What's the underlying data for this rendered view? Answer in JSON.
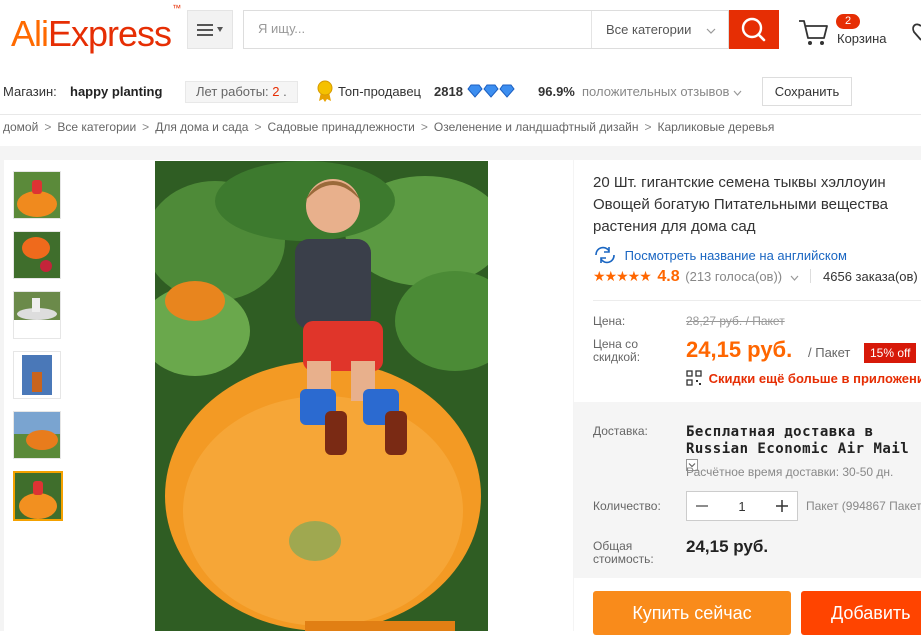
{
  "header": {
    "logo_part1": "Ali",
    "logo_part2": "Express",
    "logo_tm": "™",
    "search_placeholder": "Я ищу...",
    "category_select": "Все категории",
    "cart_count": "2",
    "cart_label": "Корзина"
  },
  "store": {
    "store_label": "Магазин:",
    "store_name": "happy planting",
    "years_label": "Лет работы:",
    "years_value": "2",
    "years_dot": ".",
    "top_seller_label": "Топ-продавец",
    "score": "2818",
    "positive_pct": "96.9%",
    "positive_label": "положительных отзывов",
    "save_button": "Сохранить"
  },
  "breadcrumb": [
    "домой",
    "Все категории",
    "Для дома и сада",
    "Садовые принадлежности",
    "Озеленение и ландшафтный дизайн",
    "Карликовые деревья"
  ],
  "breadcrumb_sep": ">",
  "product": {
    "title": "20 Шт. гигантские семена тыквы хэллоуин Овощей богатую Питательными вещества растения для дома сад",
    "translate_link": "Посмотреть название на английском",
    "rating": "4.8",
    "votes": "(213 голоса(ов))",
    "orders": "4656 заказа(ов)",
    "price_label": "Цена:",
    "old_price": "28,27 руб. / Пакет",
    "discount_label": "Цена со скидкой:",
    "price": "24,15 руб.",
    "unit": "/ Пакет",
    "discount_badge": "15% off",
    "app_promo": "Скидки ещё больше в приложении",
    "shipping_label": "Доставка:",
    "shipping_title": "Бесплатная доставка в Russian Economic Air Mail",
    "shipping_time": "Расчётное время доставки: 30-50 дн.",
    "qty_label": "Количество:",
    "qty_value": "1",
    "stock": "Пакет (994867 Пакет",
    "total_label": "Общая стоимость:",
    "total": "24,15 руб.",
    "buy_button": "Купить сейчас",
    "add_button": "Добавить"
  },
  "colors": {
    "brand_orange": "#ff6a00",
    "brand_red": "#e62e04",
    "price_orange": "#ff6600",
    "buy_orange": "#f98b1b"
  }
}
